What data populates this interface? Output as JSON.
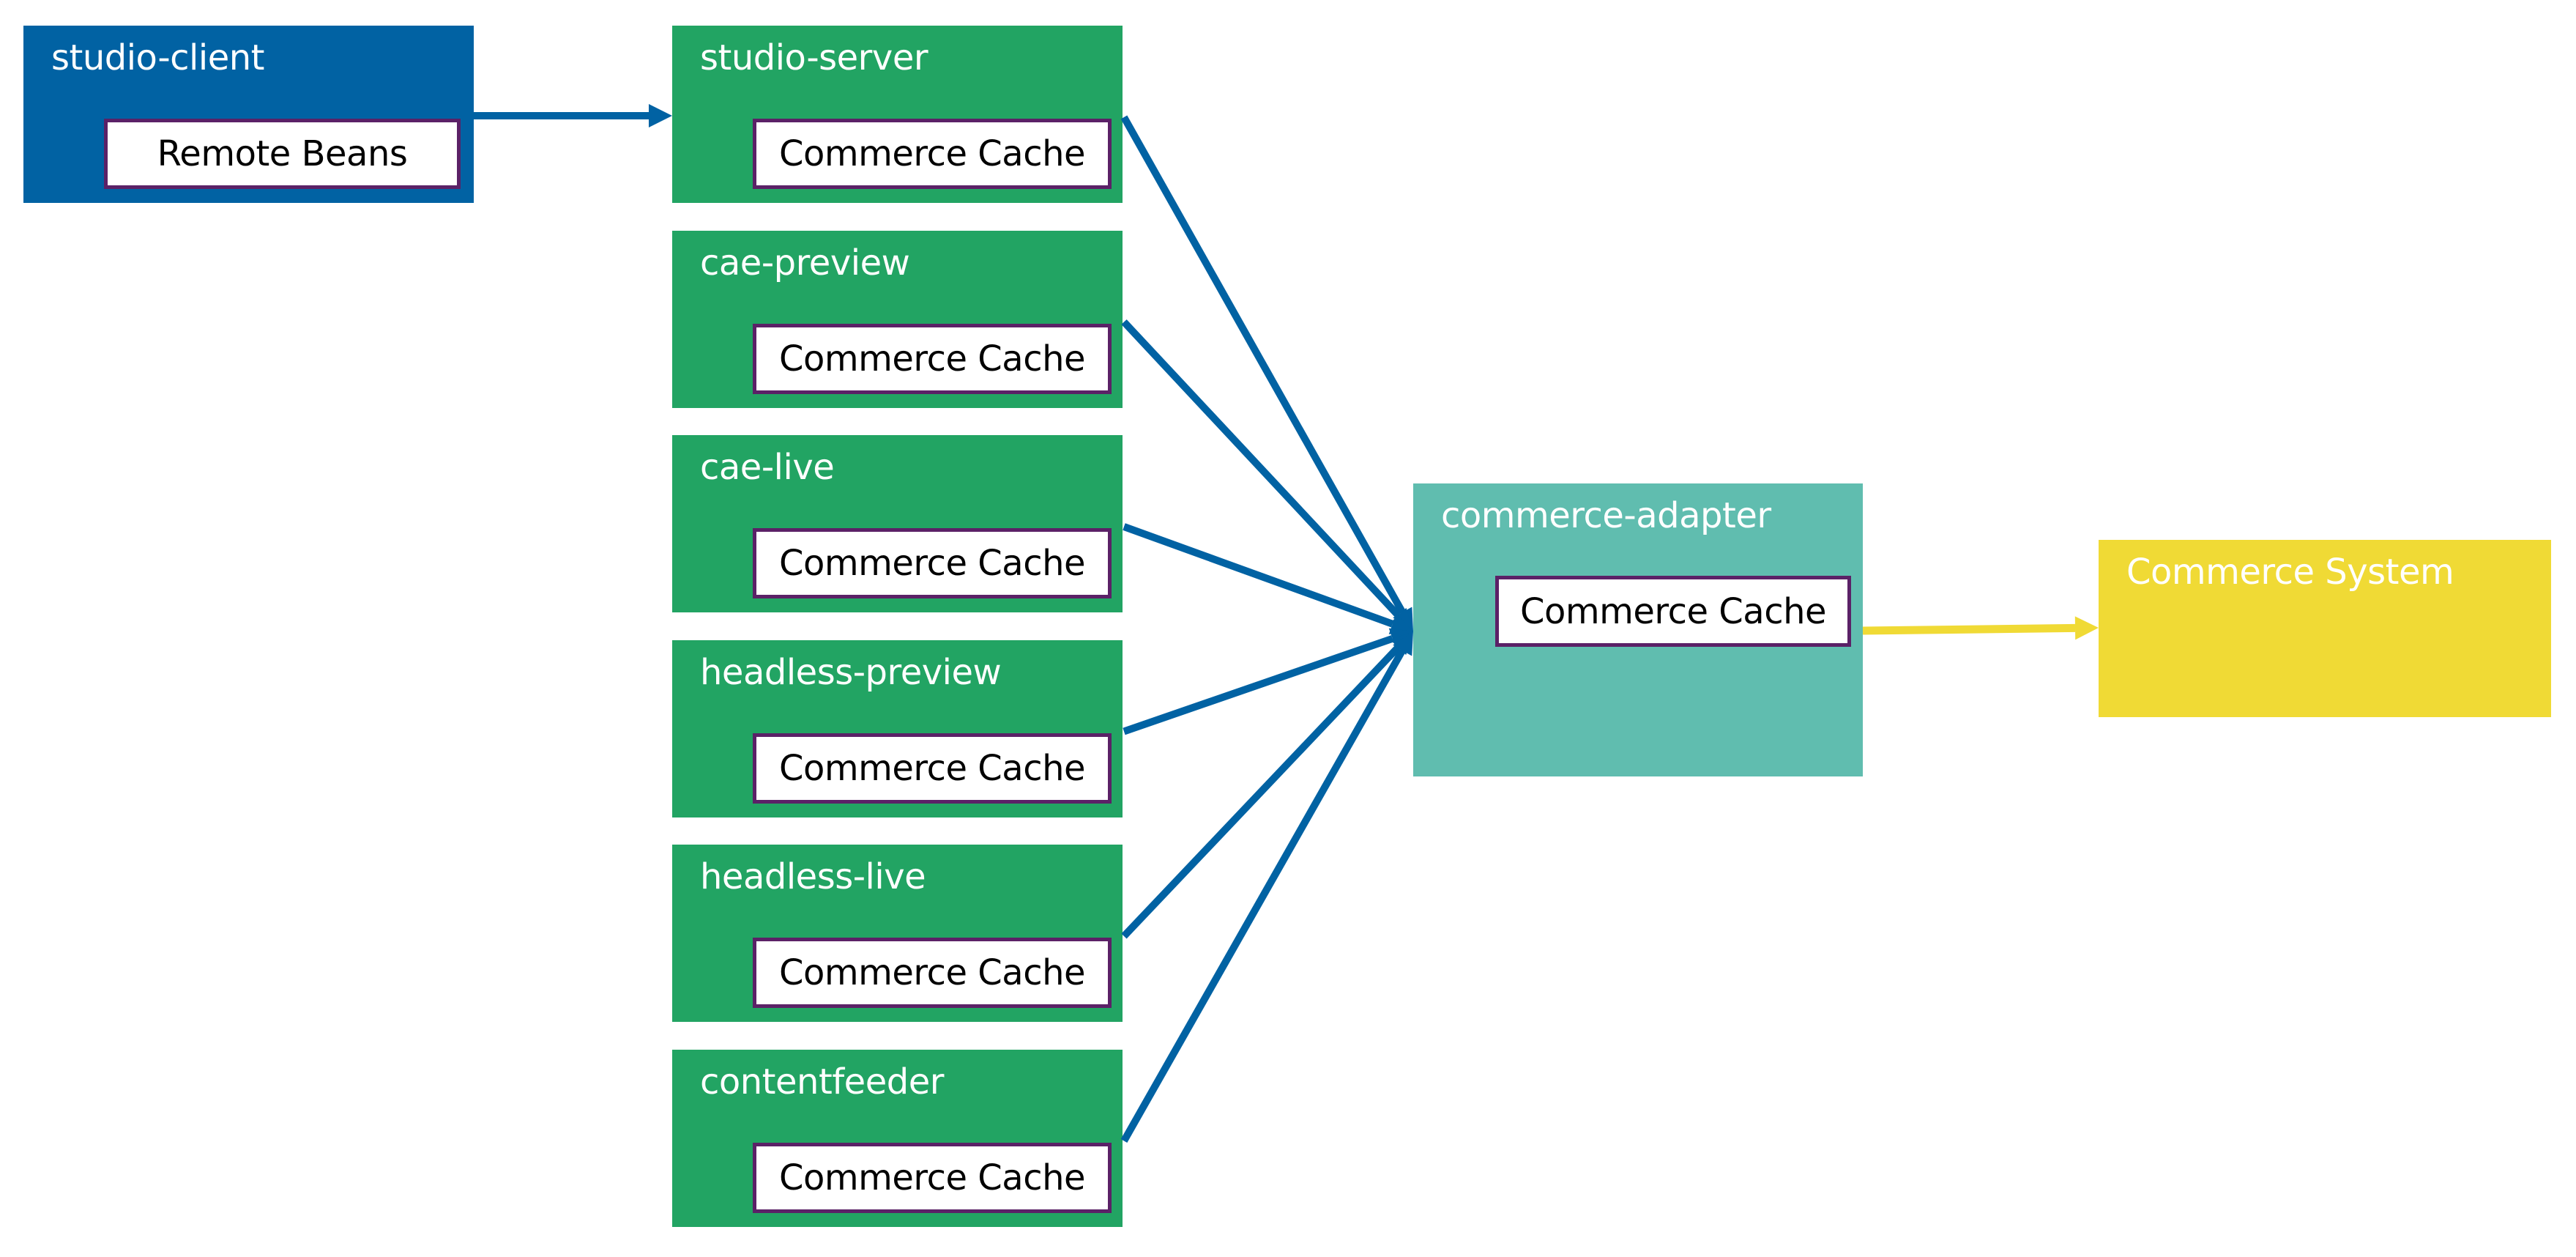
{
  "diagram": {
    "colors": {
      "client": "#0162a3",
      "server": "#22a463",
      "adapter": "#60bdaf",
      "system": "#f0da35",
      "inner_border": "#5b2167",
      "connector_blue": "#0162a3",
      "connector_yellow": "#f0da35"
    },
    "client": {
      "title": "studio-client",
      "component": "Remote Beans"
    },
    "servers": [
      {
        "title": "studio-server",
        "component": "Commerce Cache"
      },
      {
        "title": "cae-preview",
        "component": "Commerce Cache"
      },
      {
        "title": "cae-live",
        "component": "Commerce Cache"
      },
      {
        "title": "headless-preview",
        "component": "Commerce Cache"
      },
      {
        "title": "headless-live",
        "component": "Commerce Cache"
      },
      {
        "title": "contentfeeder",
        "component": "Commerce Cache"
      }
    ],
    "adapter": {
      "title": "commerce-adapter",
      "component": "Commerce Cache"
    },
    "system": {
      "title": "Commerce System"
    },
    "connections": [
      {
        "from": "studio-client",
        "to": "studio-server"
      },
      {
        "from": "studio-server",
        "to": "commerce-adapter"
      },
      {
        "from": "cae-preview",
        "to": "commerce-adapter"
      },
      {
        "from": "cae-live",
        "to": "commerce-adapter"
      },
      {
        "from": "headless-preview",
        "to": "commerce-adapter"
      },
      {
        "from": "headless-live",
        "to": "commerce-adapter"
      },
      {
        "from": "contentfeeder",
        "to": "commerce-adapter"
      },
      {
        "from": "commerce-adapter",
        "to": "Commerce System"
      }
    ]
  }
}
